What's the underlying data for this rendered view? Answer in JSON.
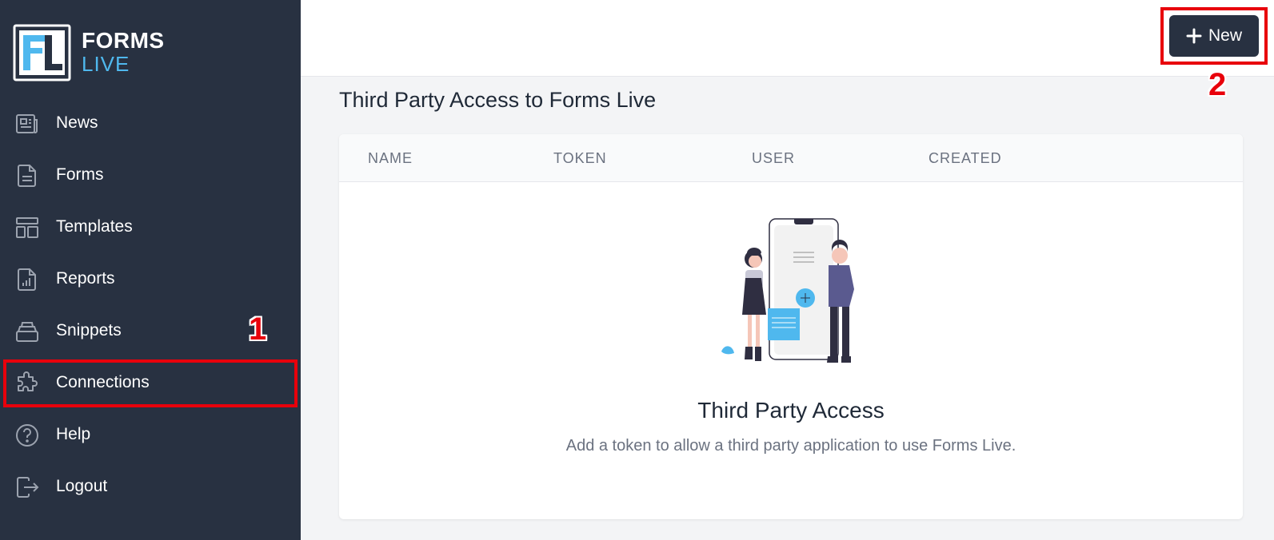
{
  "logo": {
    "line1": "FORMS",
    "line2": "LIVE",
    "mark": "FL"
  },
  "sidebar": {
    "items": [
      {
        "label": "News",
        "icon": "newspaper-icon"
      },
      {
        "label": "Forms",
        "icon": "document-icon"
      },
      {
        "label": "Templates",
        "icon": "template-icon"
      },
      {
        "label": "Reports",
        "icon": "report-icon"
      },
      {
        "label": "Snippets",
        "icon": "snippets-icon"
      },
      {
        "label": "Connections",
        "icon": "puzzle-icon"
      },
      {
        "label": "Help",
        "icon": "help-icon"
      },
      {
        "label": "Logout",
        "icon": "logout-icon"
      }
    ]
  },
  "annotations": {
    "one": "1",
    "two": "2"
  },
  "header": {
    "new_label": "New"
  },
  "page": {
    "title": "Third Party Access to Forms Live"
  },
  "table": {
    "columns": [
      "NAME",
      "TOKEN",
      "USER",
      "CREATED"
    ]
  },
  "empty_state": {
    "title": "Third Party Access",
    "description": "Add a token to allow a third party application to use Forms Live."
  },
  "colors": {
    "sidebar": "#283141",
    "accent": "#4fb8ee",
    "annotation": "#e8000b"
  }
}
